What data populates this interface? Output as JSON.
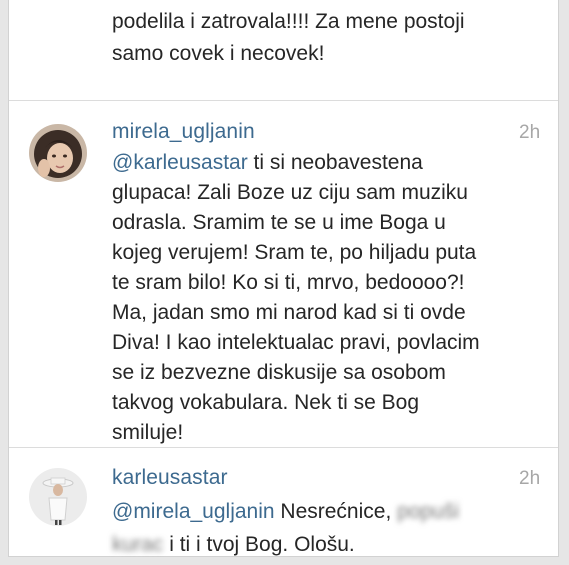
{
  "previous_comment": {
    "lines": [
      "podelila i zatrovala!!!! Za mene postoji",
      "samo covek i necovek!"
    ]
  },
  "comments": [
    {
      "username": "mirela_ugljanin",
      "time": "2h",
      "mention": "@karleusastar",
      "lines": [
        " ti si neobavestena",
        "glupaca! Zali Boze uz ciju sam muziku",
        "odrasla. Sramim te se u ime Boga u",
        "kojeg verujem! Sram te, po hiljadu puta",
        "te sram bilo! Ko si ti, mrvo, bedoooo?!",
        "Ma,  jadan smo mi narod kad si ti ovde",
        "Diva! I kao intelektualac pravi, povlacim",
        "se iz bezvezne diskusije  sa osobom",
        "takvog vokabulara. Nek ti se Bog",
        "smiluje!"
      ]
    },
    {
      "username": "karleusastar",
      "time": "2h",
      "mention": "@mirela_ugljanin",
      "text_a": " Nesrećnice, ",
      "blur_a": "popuši",
      "blur_b": "kurac",
      "text_b": " i ti i tvoj Bog. Ološu."
    }
  ],
  "colors": {
    "username": "#3d6a8f",
    "text": "#262626",
    "time": "#a7a7a7"
  }
}
